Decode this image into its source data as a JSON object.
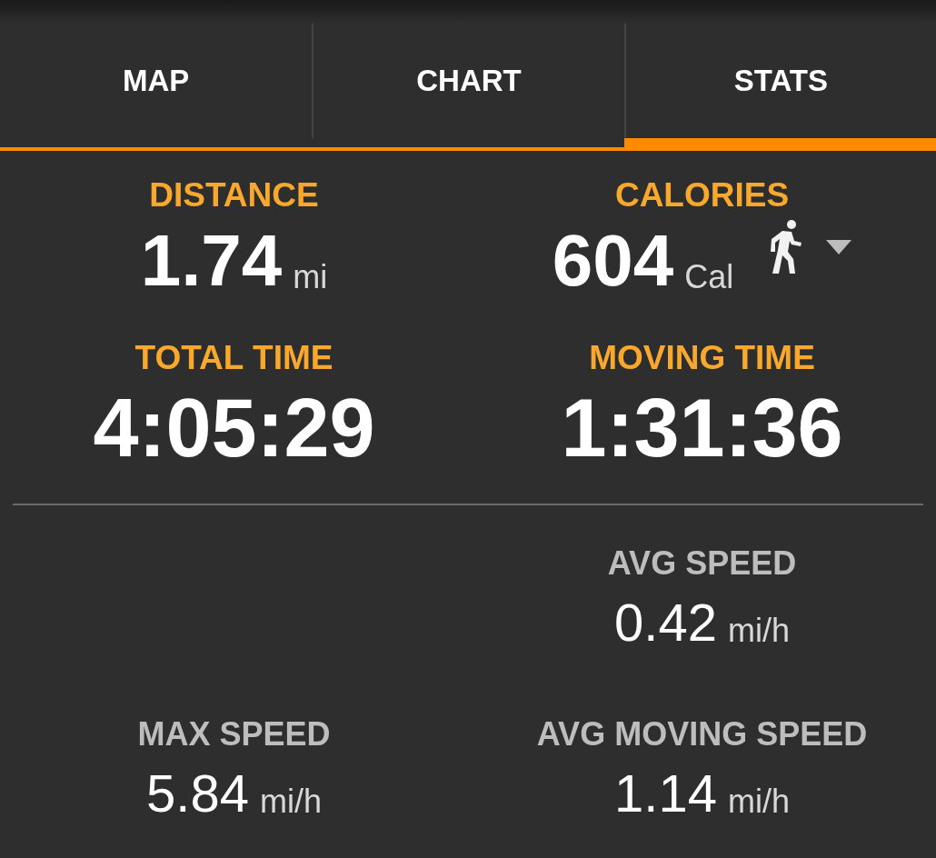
{
  "tabs": [
    {
      "label": "MAP",
      "selected": false
    },
    {
      "label": "CHART",
      "selected": false
    },
    {
      "label": "STATS",
      "selected": true
    }
  ],
  "primary_stats": [
    {
      "kind": "plain",
      "label": "DISTANCE",
      "value": "1.74",
      "unit": "mi"
    },
    {
      "kind": "activity",
      "label": "CALORIES",
      "value": "604",
      "unit": "Cal"
    },
    {
      "kind": "plain",
      "label": "TOTAL TIME",
      "value": "4:05:29"
    },
    {
      "kind": "plain",
      "label": "MOVING TIME",
      "value": "1:31:36"
    }
  ],
  "secondary_rows": [
    {
      "right": {
        "label": "AVG SPEED",
        "value": "0.42",
        "unit": "mi/h"
      }
    },
    {
      "left": {
        "label": "MAX SPEED",
        "value": "5.84",
        "unit": "mi/h"
      },
      "right": {
        "label": "AVG MOVING SPEED",
        "value": "1.14",
        "unit": "mi/h"
      }
    }
  ]
}
